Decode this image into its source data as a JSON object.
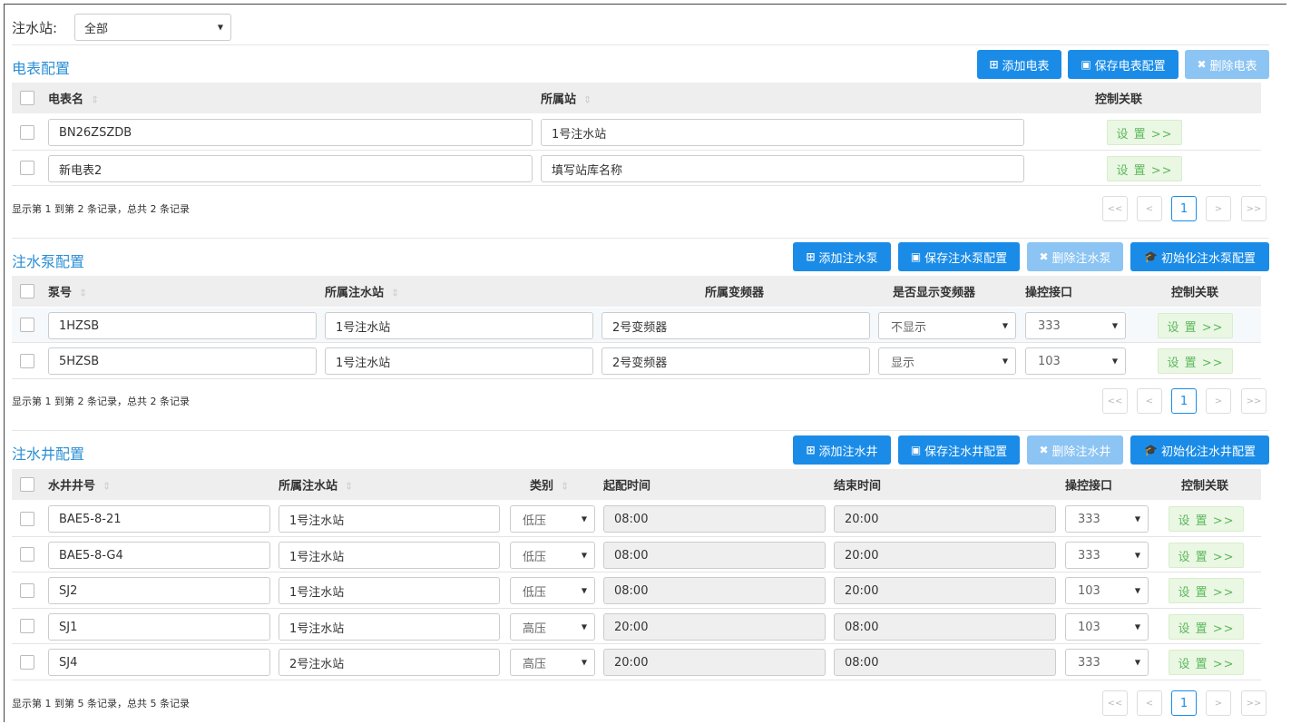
{
  "top": {
    "label": "注水站:",
    "station_value": "全部"
  },
  "meter": {
    "title": "电表配置",
    "buttons": {
      "add": "添加电表",
      "save": "保存电表配置",
      "delete": "删除电表"
    },
    "headers": {
      "name": "电表名",
      "station": "所属站",
      "ctrl": "控制关联"
    },
    "rows": [
      {
        "name": "BN26ZSZDB",
        "station": "1号注水站",
        "set": "设 置 >>"
      },
      {
        "name": "新电表2",
        "station": "填写站库名称",
        "set": "设 置 >>"
      }
    ],
    "info": "显示第 1 到第 2 条记录，总共 2 条记录",
    "pager": {
      "first": "<<",
      "prev": "<",
      "page": "1",
      "next": ">",
      "last": ">>"
    }
  },
  "pump": {
    "title": "注水泵配置",
    "buttons": {
      "add": "添加注水泵",
      "save": "保存注水泵配置",
      "delete": "删除注水泵",
      "init": "初始化注水泵配置"
    },
    "headers": {
      "no": "泵号",
      "station": "所属注水站",
      "inverter": "所属变频器",
      "show": "是否显示变频器",
      "port": "操控接口",
      "ctrl": "控制关联"
    },
    "rows": [
      {
        "no": "1HZSB",
        "station": "1号注水站",
        "inverter": "2号变频器",
        "show": "不显示",
        "port": "333",
        "set": "设 置 >>"
      },
      {
        "no": "5HZSB",
        "station": "1号注水站",
        "inverter": "2号变频器",
        "show": "显示",
        "port": "103",
        "set": "设 置 >>"
      }
    ],
    "info": "显示第 1 到第 2 条记录，总共 2 条记录",
    "pager": {
      "first": "<<",
      "prev": "<",
      "page": "1",
      "next": ">",
      "last": ">>"
    }
  },
  "well": {
    "title": "注水井配置",
    "buttons": {
      "add": "添加注水井",
      "save": "保存注水井配置",
      "delete": "删除注水井",
      "init": "初始化注水井配置"
    },
    "headers": {
      "no": "水井井号",
      "station": "所属注水站",
      "type": "类别",
      "start": "起配时间",
      "end": "结束时间",
      "port": "操控接口",
      "ctrl": "控制关联"
    },
    "rows": [
      {
        "no": "BAE5-8-21",
        "station": "1号注水站",
        "type": "低压",
        "start": "08:00",
        "end": "20:00",
        "port": "333",
        "set": "设 置 >>"
      },
      {
        "no": "BAE5-8-G4",
        "station": "1号注水站",
        "type": "低压",
        "start": "08:00",
        "end": "20:00",
        "port": "333",
        "set": "设 置 >>"
      },
      {
        "no": "SJ2",
        "station": "1号注水站",
        "type": "低压",
        "start": "08:00",
        "end": "20:00",
        "port": "103",
        "set": "设 置 >>"
      },
      {
        "no": "SJ1",
        "station": "1号注水站",
        "type": "高压",
        "start": "20:00",
        "end": "08:00",
        "port": "103",
        "set": "设 置 >>"
      },
      {
        "no": "SJ4",
        "station": "2号注水站",
        "type": "高压",
        "start": "20:00",
        "end": "08:00",
        "port": "333",
        "set": "设 置 >>"
      }
    ],
    "info": "显示第 1 到第 5 条记录，总共 5 条记录",
    "pager": {
      "first": "<<",
      "prev": "<",
      "page": "1",
      "next": ">",
      "last": ">>"
    }
  },
  "colors": {
    "primary": "#1a8ce8",
    "primary_disabled": "#8cc4f3",
    "title": "#2a8fd6",
    "set_bg": "#eaf7e3",
    "set_text": "#5cb85c"
  }
}
